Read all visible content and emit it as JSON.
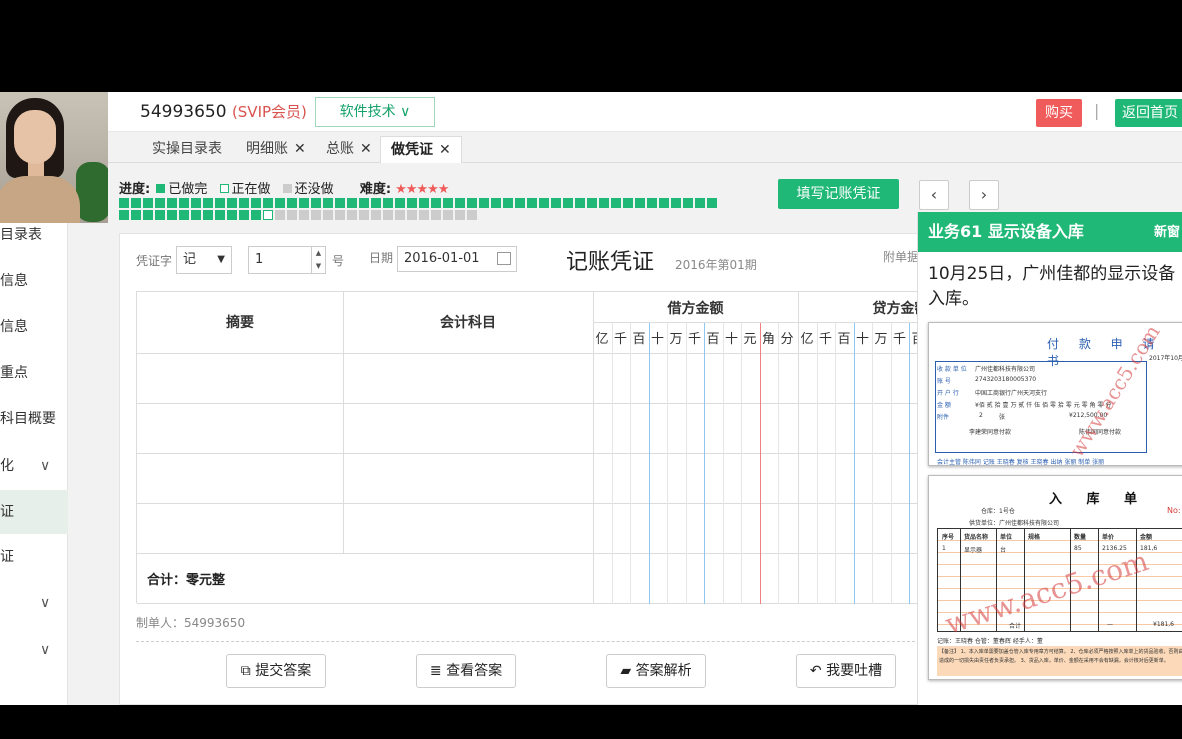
{
  "header": {
    "account_id": "54993650",
    "account_level": "(SVIP会员)",
    "software_btn": "软件技术",
    "buy_btn": "购买",
    "separator": "|",
    "home_btn": "返回首页"
  },
  "tabs": [
    {
      "label": "实操目录表",
      "closable": false
    },
    {
      "label": "明细账",
      "closable": true
    },
    {
      "label": "总账",
      "closable": true
    },
    {
      "label": "做凭证",
      "closable": true,
      "active": true
    }
  ],
  "sidebar": {
    "items": [
      {
        "label": "目录表"
      },
      {
        "label": "信息"
      },
      {
        "label": "信息"
      },
      {
        "label": "重点"
      },
      {
        "label": "科目概要"
      },
      {
        "label": "化",
        "chevron": "∨"
      },
      {
        "label": "证",
        "active": true
      },
      {
        "label": "证"
      },
      {
        "label": "",
        "chevron": "∨"
      },
      {
        "label": "",
        "chevron": "∨"
      }
    ]
  },
  "progress": {
    "label": "进度:",
    "done_label": "已做完",
    "doing_label": "正在做",
    "todo_label": "还没做",
    "difficulty_label": "难度:",
    "stars": "★★★★★",
    "done_count": 62,
    "current_index": 62,
    "total_count": 80,
    "colors": {
      "done": "#1fb877",
      "todo": "#cccccc"
    }
  },
  "actions": {
    "fill_voucher_btn": "填写记账凭证",
    "prev_icon": "‹",
    "next_icon": "›"
  },
  "voucher": {
    "type_label": "凭证字",
    "type_value": "记",
    "number_value": "1",
    "number_suffix": "号",
    "date_label": "日期",
    "date_value": "2016-01-01",
    "title": "记账凭证",
    "period": "2016年第01期",
    "attach_label": "附单据",
    "columns": {
      "summary": "摘要",
      "account": "会计科目",
      "debit": "借方金额",
      "credit": "贷方金额"
    },
    "digits": [
      "亿",
      "千",
      "百",
      "十",
      "万",
      "千",
      "百",
      "十",
      "元",
      "角",
      "分"
    ],
    "total_label": "合计：零元整",
    "maker": "制单人：54993650"
  },
  "buttons": {
    "submit": "提交答案",
    "view": "查看答案",
    "analysis": "答案解析",
    "complain": "我要吐槽"
  },
  "right_panel": {
    "title": "业务61 显示设备入库",
    "new_window": "新窗",
    "description": "10月25日，广州佳都的显示设备入库。",
    "doc1": {
      "title": "付 款 申 请 书",
      "date": "2017年10月",
      "payee_label": "收 款 单 位",
      "payee": "广州佳都科技有限公司",
      "account_label": "账 号",
      "account": "2743203180005370",
      "bank_label": "开 户 行",
      "bank": "中国工商银行广州天河支行",
      "amount_label": "金 额",
      "amount_words": "¥佰 贰 拾 壹 万 贰 仟 伍 佰 零 拾 零 元 零 角 零 分",
      "amount": "¥212,500.00",
      "attach_label": "附件",
      "attach": "2",
      "attach_unit": "张",
      "approve1": "李建荣同意付款",
      "approve2": "陈伟同同意付款",
      "sign": "会计主管 陈伟同  记账 王晓春  复核 王晓春  出纳 张丽  制单 张丽",
      "watermark": "www.acc5.com"
    },
    "doc2": {
      "title": "入 库 单",
      "warehouse": "仓库：1号仓",
      "supplier": "供货单位：广州佳都科技有限公司",
      "no_label": "No:",
      "headers": [
        "序号",
        "货品名称",
        "单位",
        "规格",
        "数量",
        "单价",
        "金额"
      ],
      "row": [
        "1",
        "显示器",
        "台",
        "",
        "85",
        "2136.25",
        "181,6"
      ],
      "total_label": "合计",
      "total_dash": "—",
      "total_value": "¥181,6",
      "sign": "记账：王晓春        仓管：董春辉        经手人：董",
      "notes": "【备注】 1、本入库单需要加盖仓管入库专用章方可结算。 2、仓库必须严格按照入库单上的货品验收，否则由此造成的一切损失由责任者负责承担。 3、货品入库，单价、金额在采用不会有缺漏，会计核对后更新单。",
      "watermark": "www.acc5.com"
    }
  }
}
